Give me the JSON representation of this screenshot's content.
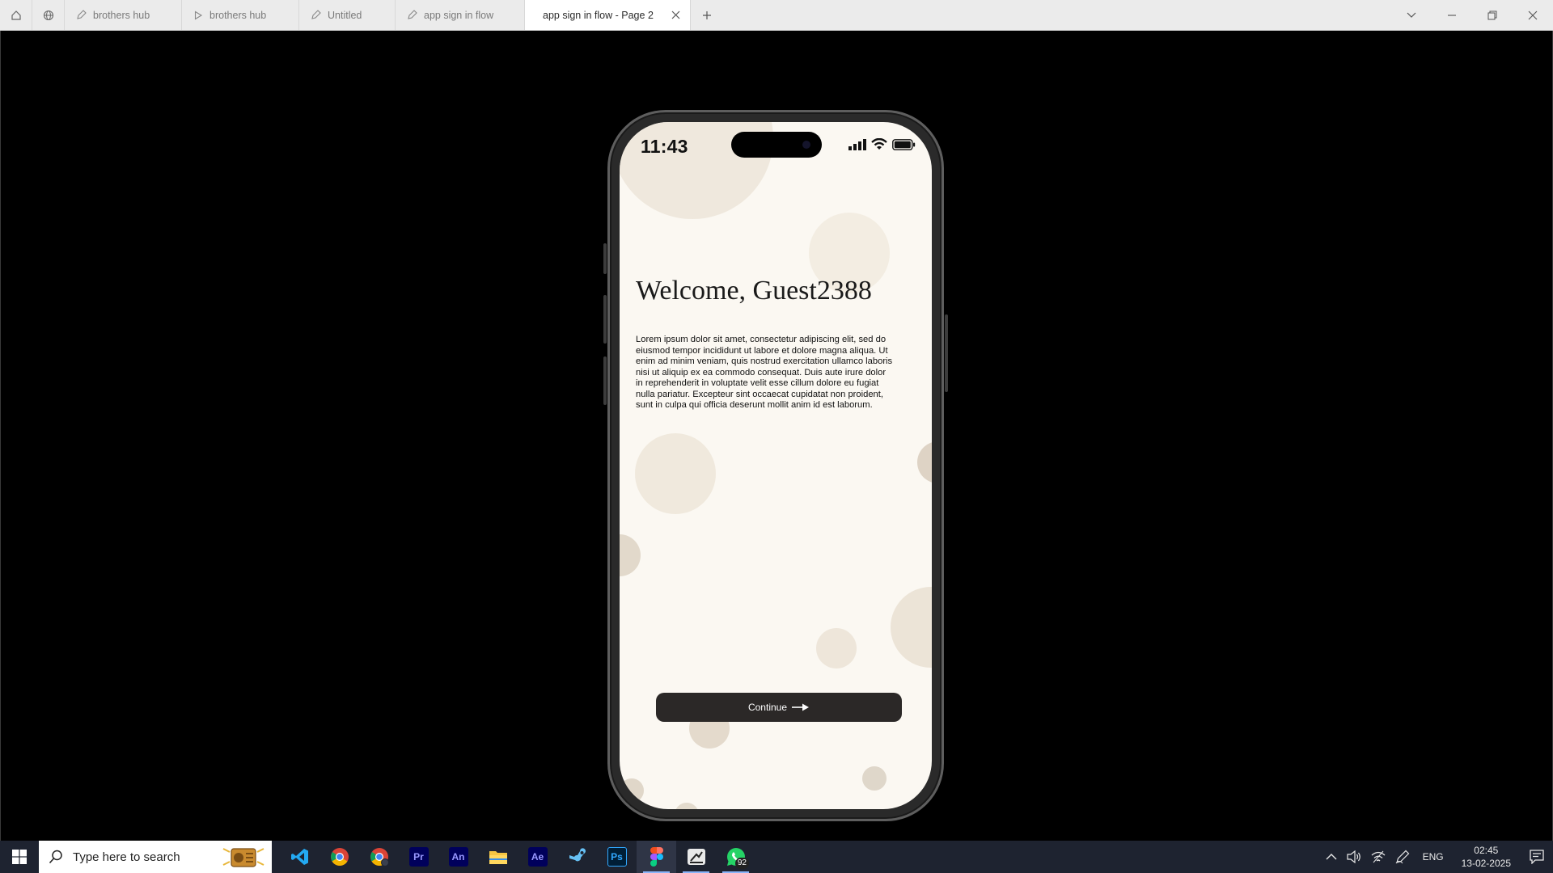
{
  "tabs": [
    {
      "label": "brothers hub",
      "icon": "pen-icon",
      "active": false
    },
    {
      "label": "brothers hub",
      "icon": "play-icon",
      "active": false
    },
    {
      "label": "Untitled",
      "icon": "pen-icon",
      "active": false
    },
    {
      "label": "app sign in flow",
      "icon": "pen-icon",
      "active": false
    },
    {
      "label": "app sign in flow - Page 2",
      "icon": "play-icon",
      "active": true
    }
  ],
  "phone": {
    "time": "11:43",
    "welcome_title": "Welcome, Guest2388",
    "body_text": "Lorem ipsum dolor sit amet, consectetur adipiscing elit, sed do eiusmod tempor incididunt ut labore et dolore magna aliqua. Ut enim ad minim veniam, quis nostrud exercitation ullamco laboris nisi ut aliquip ex ea commodo consequat. Duis aute irure dolor in reprehenderit in voluptate velit esse cillum dolore eu fugiat nulla pariatur. Excepteur sint occaecat cupidatat non proident, sunt in culpa qui officia deserunt mollit anim id est laborum.",
    "continue_label": "Continue"
  },
  "taskbar": {
    "search_placeholder": "Type here to search",
    "apps": [
      "vscode",
      "chrome",
      "chrome-profile",
      "premiere-pro",
      "animate",
      "file-explorer",
      "after-effects",
      "steam",
      "photoshop",
      "figma",
      "app-launcher",
      "whatsapp"
    ],
    "whatsapp_badge": "92",
    "language": "ENG",
    "time": "02:45",
    "date": "13-02-2025"
  },
  "colors": {
    "screen_bg": "#fbf8f2",
    "button_bg": "#2b2827",
    "taskbar_bg": "#1e2330",
    "active_tab_bg": "#ffffff"
  }
}
